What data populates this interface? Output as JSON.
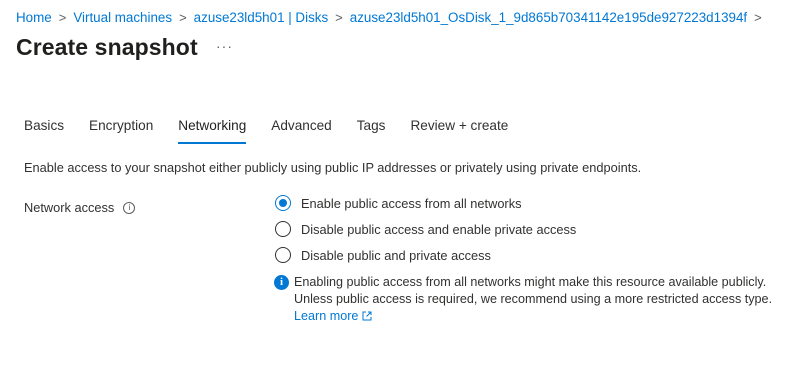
{
  "breadcrumb": {
    "items": [
      "Home",
      "Virtual machines",
      "azuse23ld5h01 | Disks",
      "azuse23ld5h01_OsDisk_1_9d865b70341142e195de927223d1394f"
    ],
    "separator": ">"
  },
  "page": {
    "title": "Create snapshot",
    "more_label": "···"
  },
  "tabs": [
    {
      "label": "Basics",
      "active": false
    },
    {
      "label": "Encryption",
      "active": false
    },
    {
      "label": "Networking",
      "active": true
    },
    {
      "label": "Advanced",
      "active": false
    },
    {
      "label": "Tags",
      "active": false
    },
    {
      "label": "Review + create",
      "active": false
    }
  ],
  "networking": {
    "description": "Enable access to your snapshot either publicly using public IP addresses or privately using private endpoints.",
    "field_label": "Network access",
    "options": [
      {
        "label": "Enable public access from all networks",
        "selected": true
      },
      {
        "label": "Disable public access and enable private access",
        "selected": false
      },
      {
        "label": "Disable public and private access",
        "selected": false
      }
    ],
    "info_message": "Enabling public access from all networks might make this resource available publicly. Unless public access is required, we recommend using a more restricted access type.",
    "learn_more": "Learn more"
  },
  "icons": {
    "info": "info-icon",
    "external_link": "external-link-icon",
    "chevron": "chevron-right-icon"
  },
  "colors": {
    "accent": "#0078d4",
    "text": "#323130"
  }
}
